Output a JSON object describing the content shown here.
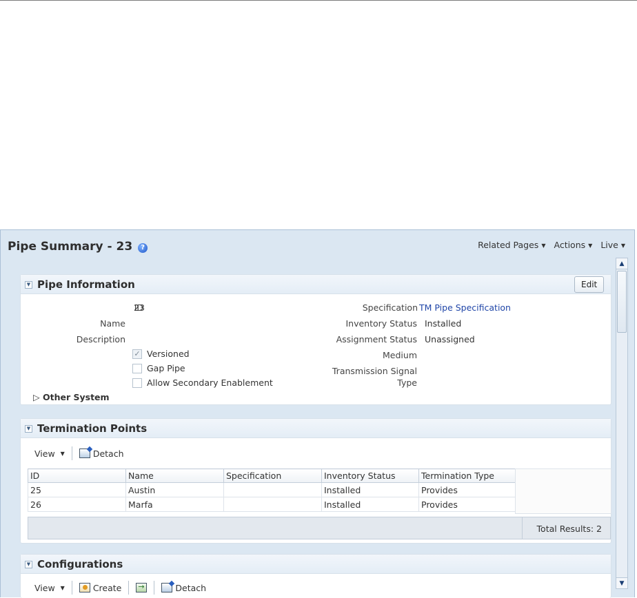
{
  "header": {
    "title": "Pipe Summary - 23",
    "menus": [
      "Related Pages",
      "Actions",
      "Live"
    ]
  },
  "pipe_info": {
    "title": "Pipe Information",
    "edit_label": "Edit",
    "left": {
      "id_label": "ID",
      "id_value": "23",
      "name_label": "Name",
      "description_label": "Description"
    },
    "checkboxes": [
      {
        "label": "Versioned",
        "checked": true
      },
      {
        "label": "Gap Pipe",
        "checked": false
      },
      {
        "label": "Allow Secondary Enablement",
        "checked": false
      }
    ],
    "right": {
      "specification_label": "Specification",
      "specification_value": "TM Pipe Specification",
      "inventory_status_label": "Inventory Status",
      "inventory_status_value": "Installed",
      "assignment_status_label": "Assignment Status",
      "assignment_status_value": "Unassigned",
      "medium_label": "Medium",
      "transmission_label_1": "Transmission Signal",
      "transmission_label_2": "Type"
    },
    "other_system": "Other System"
  },
  "termination_points": {
    "title": "Termination Points",
    "toolbar": {
      "view": "View",
      "detach": "Detach"
    },
    "columns": [
      "ID",
      "Name",
      "Specification",
      "Inventory Status",
      "Termination Type"
    ],
    "rows": [
      {
        "id": "25",
        "name": "Austin",
        "specification": "",
        "inventory_status": "Installed",
        "termination_type": "Provides"
      },
      {
        "id": "26",
        "name": "Marfa",
        "specification": "",
        "inventory_status": "Installed",
        "termination_type": "Provides"
      }
    ],
    "total": "Total Results: 2"
  },
  "configurations": {
    "title": "Configurations",
    "toolbar": {
      "view": "View",
      "create": "Create",
      "detach": "Detach"
    }
  },
  "colors": {
    "link": "#2046a8",
    "frame": "#dbe7f2",
    "panel_header": "#e4edf6"
  },
  "icons": [
    "help-icon",
    "chevron-down-icon",
    "detach-icon",
    "create-icon",
    "export-icon",
    "scroll-up-icon",
    "scroll-down-icon"
  ]
}
